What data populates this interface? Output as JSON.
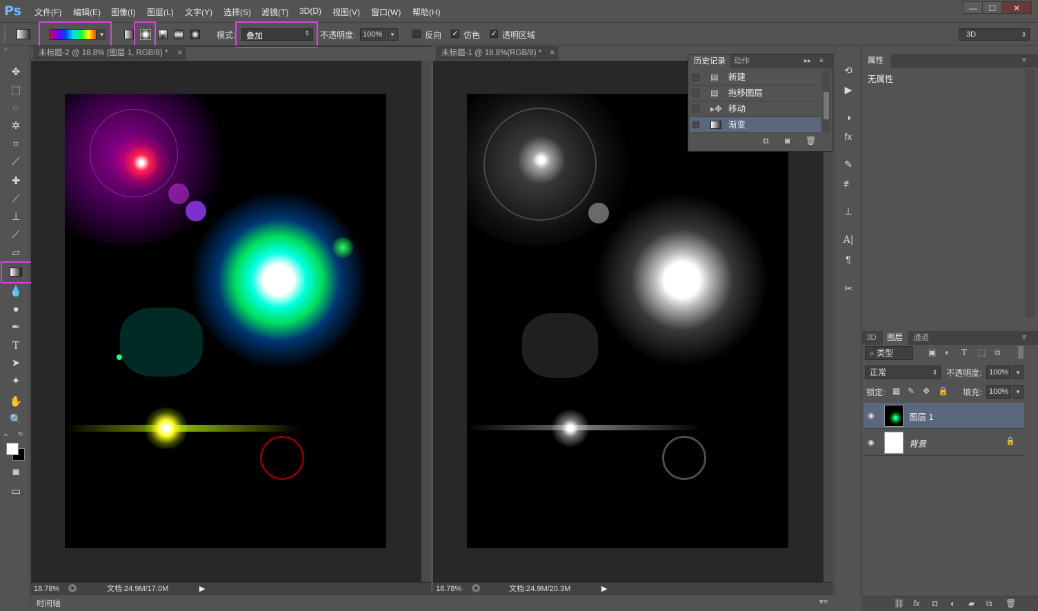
{
  "app": {
    "logo": "Ps"
  },
  "menu": [
    "文件(F)",
    "编辑(E)",
    "图像(I)",
    "图层(L)",
    "文字(Y)",
    "选择(S)",
    "滤镜(T)",
    "3D(D)",
    "视图(V)",
    "窗口(W)",
    "帮助(H)"
  ],
  "window_buttons": {
    "minimize": "—",
    "restore": "☐",
    "close": "✕"
  },
  "options": {
    "mode_label": "模式:",
    "mode_value": "叠加",
    "opacity_label": "不透明度:",
    "opacity_value": "100%",
    "reverse_label": "反向",
    "dither_label": "仿色",
    "transparency_label": "透明区域",
    "workspace_value": "3D",
    "reverse_checked": false,
    "dither_checked": true,
    "transparency_checked": true
  },
  "tabs": {
    "doc1": "未标题-2 @ 18.8% (图层 1, RGB/8) *",
    "doc2": "未标题-1 @ 18.8%(RGB/8) *",
    "close": "×"
  },
  "status": {
    "zoom1": "18.78%",
    "doc1": "文档:24.9M/17.0M",
    "zoom2": "18.78%",
    "doc2": "文档:24.9M/20.3M"
  },
  "timeline": "时间轴",
  "history": {
    "tab_history": "历史记录",
    "tab_actions": "动作",
    "items": [
      "新建",
      "拖移图层",
      "移动",
      "渐变"
    ]
  },
  "properties": {
    "title": "属性",
    "empty": "无属性"
  },
  "layers": {
    "tabs": [
      "3D",
      "图层",
      "通道"
    ],
    "filter": "类型",
    "blend": "正常",
    "opacity_label": "不透明度:",
    "opacity_value": "100%",
    "lock_label": "锁定:",
    "fill_label": "填充:",
    "fill_value": "100%",
    "items": [
      "图层 1",
      "背景"
    ]
  },
  "colors": {
    "accent_highlight": "#e43ee6",
    "panel_bg": "#535353",
    "selected_row": "#5a677d"
  }
}
